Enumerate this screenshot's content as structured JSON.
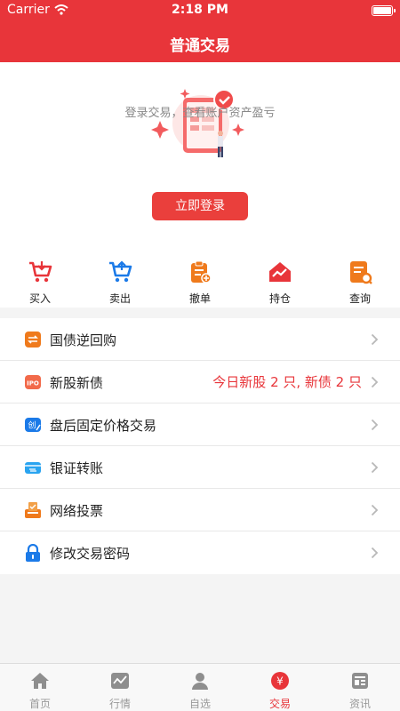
{
  "status_bar": {
    "carrier": "Carrier",
    "time": "2:18 PM"
  },
  "header": {
    "title": "普通交易"
  },
  "login": {
    "hint": "登录交易，查看账户资产盈亏",
    "button_label": "立即登录"
  },
  "quick_actions": [
    {
      "label": "买入",
      "icon": "cart-down-icon"
    },
    {
      "label": "卖出",
      "icon": "cart-up-icon"
    },
    {
      "label": "撤单",
      "icon": "cancel-order-icon"
    },
    {
      "label": "持仓",
      "icon": "position-icon"
    },
    {
      "label": "查询",
      "icon": "query-icon"
    }
  ],
  "menu": [
    {
      "label": "国债逆回购",
      "icon": "repo-icon",
      "extra": ""
    },
    {
      "label": "新股新债",
      "icon": "ipo-icon",
      "extra": "今日新股 2 只, 新债 2 只"
    },
    {
      "label": "盘后固定价格交易",
      "icon": "after-hours-icon",
      "extra": ""
    },
    {
      "label": "银证转账",
      "icon": "bank-transfer-icon",
      "extra": ""
    },
    {
      "label": "网络投票",
      "icon": "vote-icon",
      "extra": ""
    },
    {
      "label": "修改交易密码",
      "icon": "lock-icon",
      "extra": ""
    }
  ],
  "tabs": [
    {
      "label": "首页",
      "icon": "home-icon",
      "active": false
    },
    {
      "label": "行情",
      "icon": "market-icon",
      "active": false
    },
    {
      "label": "自选",
      "icon": "watchlist-icon",
      "active": false
    },
    {
      "label": "交易",
      "icon": "trade-icon",
      "active": true
    },
    {
      "label": "资讯",
      "icon": "news-icon",
      "active": false
    }
  ],
  "colors": {
    "brand": "#e8353a",
    "accent_orange": "#ef7a1c",
    "accent_blue": "#1b7ae8"
  }
}
